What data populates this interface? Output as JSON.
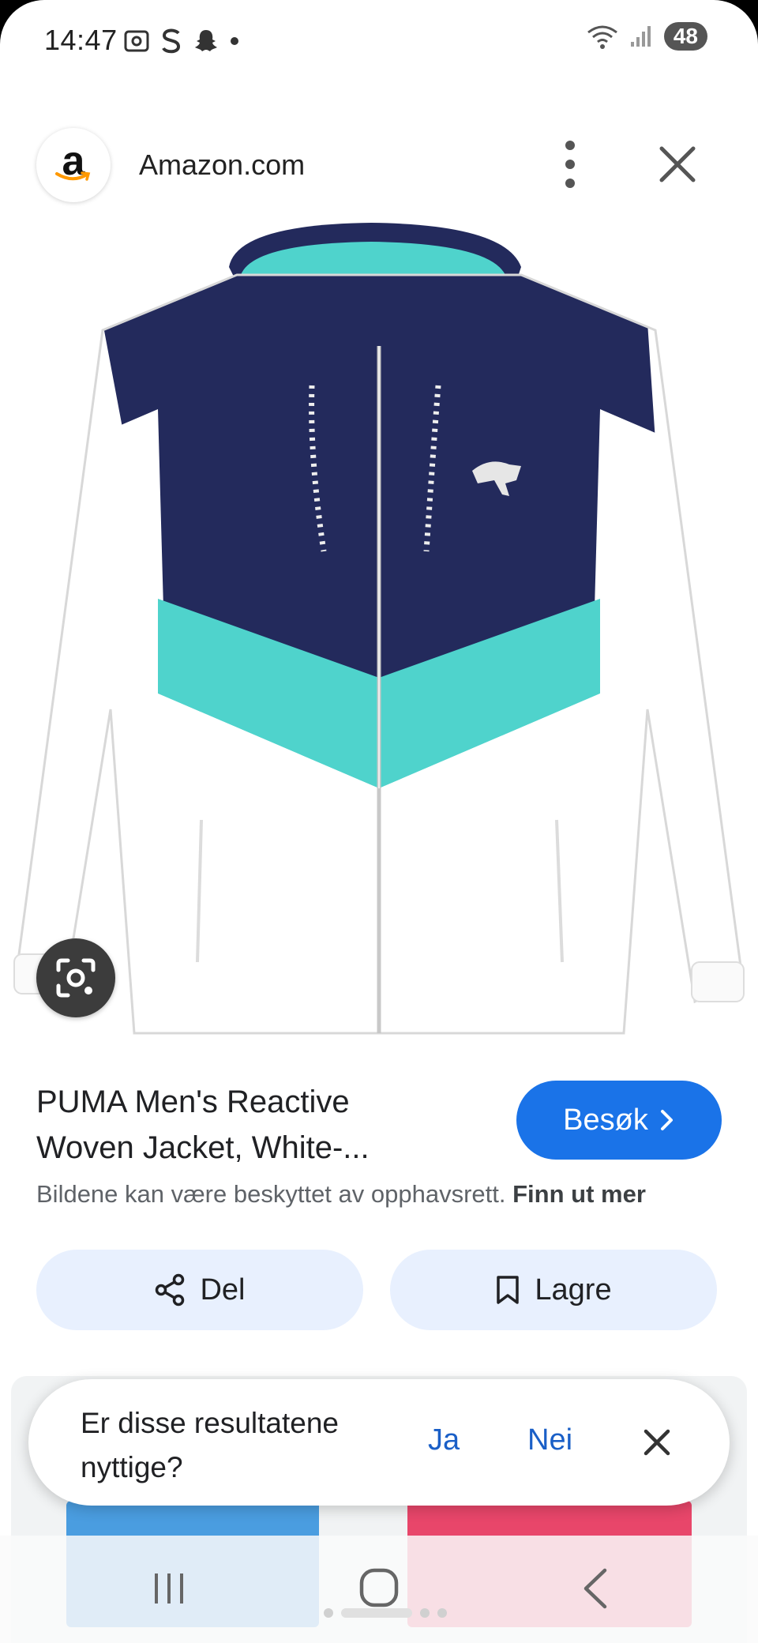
{
  "status_bar": {
    "time": "14:47",
    "battery": "48"
  },
  "header": {
    "site_name": "Amazon.com",
    "favicon_letter": "a"
  },
  "product": {
    "title_line1": "PUMA Men's Reactive",
    "title_line2": "Woven Jacket, White-...",
    "visit_label": "Besøk",
    "copyright_text": "Bildene kan være beskyttet av opphavsrett.",
    "learn_more": "Finn ut mer",
    "colors": {
      "navy": "#232a5c",
      "teal": "#4fd3cc",
      "white": "#ffffff"
    }
  },
  "actions": {
    "share_label": "Del",
    "save_label": "Lagre"
  },
  "feedback": {
    "question": "Er disse resultatene nyttige?",
    "yes_label": "Ja",
    "no_label": "Nei"
  },
  "icons": [
    "screenshot-icon",
    "s-icon",
    "snapchat-icon",
    "wifi-icon",
    "signal-icon",
    "more-vert-icon",
    "close-icon",
    "lens-icon",
    "share-icon",
    "bookmark-icon",
    "chevron-right-icon"
  ],
  "theme": {
    "accent": "#1a73e8",
    "pill_bg": "#e8f0fe"
  }
}
